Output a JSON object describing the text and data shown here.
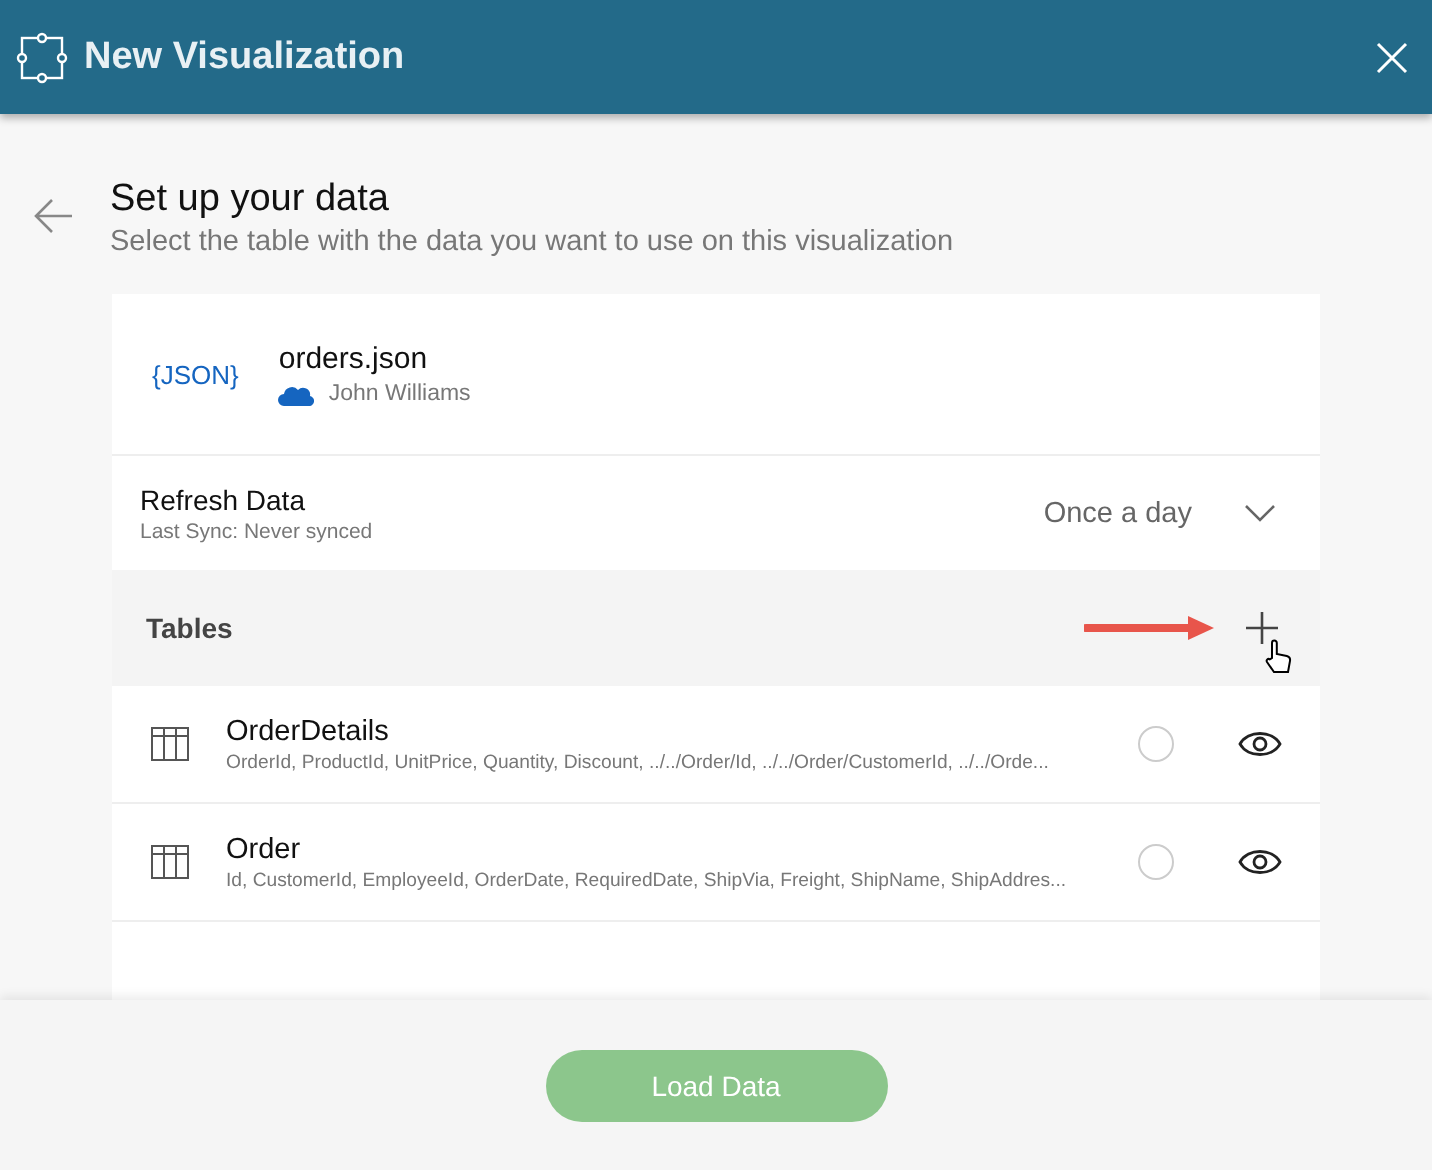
{
  "window": {
    "title": "New Visualization"
  },
  "header": {
    "title": "Set up your data",
    "subtitle": "Select the table with the data you want to use on this visualization"
  },
  "source": {
    "badge": "{JSON}",
    "name": "orders.json",
    "owner": "John Williams"
  },
  "refresh": {
    "title": "Refresh Data",
    "last_sync": "Last Sync: Never synced",
    "frequency": "Once a day"
  },
  "tables": {
    "title": "Tables",
    "rows": [
      {
        "name": "OrderDetails",
        "fields": "OrderId, ProductId, UnitPrice, Quantity, Discount, ../../Order/Id, ../../Order/CustomerId, ../../Orde...",
        "selected": false
      },
      {
        "name": "Order",
        "fields": "Id, CustomerId, EmployeeId, OrderDate, RequiredDate, ShipVia, Freight, ShipName, ShipAddres...",
        "selected": false
      }
    ]
  },
  "footer": {
    "button": {
      "label": "Load Data",
      "disabled": true
    }
  }
}
